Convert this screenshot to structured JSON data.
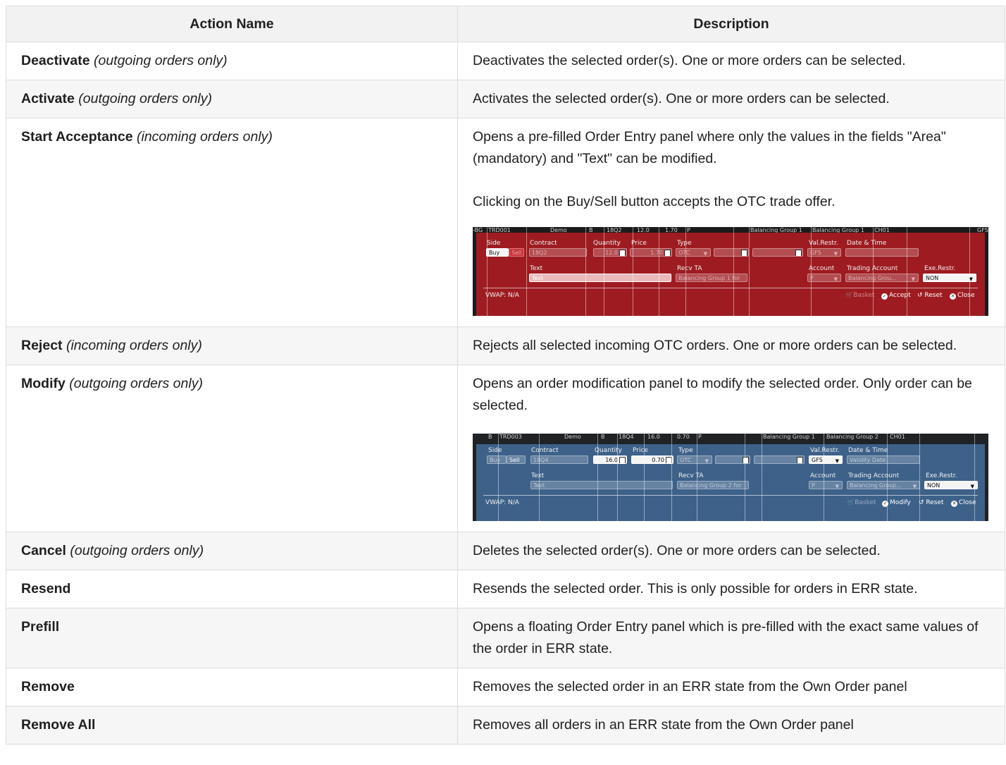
{
  "headers": {
    "name": "Action Name",
    "description": "Description"
  },
  "rows": [
    {
      "action": "Deactivate",
      "note": "(outgoing orders only)",
      "desc": [
        "Deactivates the selected order(s). One or more orders can be selected."
      ]
    },
    {
      "action": "Activate",
      "note": "(outgoing orders only)",
      "desc": [
        "Activates the selected order(s). One or more orders can be selected."
      ]
    },
    {
      "action": "Start Acceptance",
      "note": "(incoming orders only)",
      "desc": [
        "Opens a pre-filled Order Entry panel where only the values in the fields \"Area\" (mandatory) and \"Text\" can be modified.",
        "Clicking on the Buy/Sell button accepts the OTC trade offer."
      ]
    },
    {
      "action": "Reject",
      "note": "(incoming orders only)",
      "desc": [
        "Rejects all selected incoming OTC orders. One or more orders can be selected."
      ]
    },
    {
      "action": "Modify",
      "note": "(outgoing orders only)",
      "desc": [
        "Opens an order modification panel to modify the selected order. Only order can be selected."
      ]
    },
    {
      "action": "Cancel",
      "note": "(outgoing orders only)",
      "desc": [
        "Deletes the selected order(s). One or more orders can be selected."
      ]
    },
    {
      "action": "Resend",
      "note": "",
      "desc": [
        "Resends the selected order. This is only possible for orders in ERR state."
      ]
    },
    {
      "action": "Prefill",
      "note": "",
      "desc": [
        "Opens a floating Order Entry panel which is pre-filled with the exact same values of the order in ERR state."
      ]
    },
    {
      "action": "Remove",
      "note": "",
      "desc": [
        "Removes the selected order in an ERR state from the Own Order panel"
      ]
    },
    {
      "action": "Remove All",
      "note": "",
      "desc": [
        "Removes all orders in an ERR state from the Own Order panel"
      ]
    }
  ],
  "accept_panel": {
    "top_strip": [
      "-BG",
      "TRD001",
      "Demo",
      "B",
      "18Q2",
      "12.0",
      "1.70",
      "P",
      "Balancing Group 1",
      "Balancing Group 1",
      "CH01",
      "GFS"
    ],
    "labels": {
      "side": "Side",
      "contract": "Contract",
      "quantity": "Quantity",
      "price": "Price",
      "type": "Type",
      "val_restr": "Val.Restr.",
      "date_time": "Date & Time",
      "text": "Text",
      "recv_ta": "Recv TA",
      "account": "Account",
      "trading_account": "Trading Account",
      "exe_restr": "Exe.Restr."
    },
    "values": {
      "buy": "Buy",
      "sell": "Sell",
      "contract": "18Q2",
      "quantity": "12.0",
      "price": "1.70",
      "type": "OTC",
      "val_restr": "GFS",
      "text_placeholder": "Text",
      "recv_ta": "Balancing Group 1 for",
      "account": "P",
      "trading_account": "Balancing Grou...",
      "exe_restr": "NON"
    },
    "vwap": "VWAP:  N/A",
    "buttons": {
      "basket": "Basket",
      "action": "Accept",
      "reset": "Reset",
      "close": "Close"
    }
  },
  "modify_panel": {
    "top_strip": [
      "B",
      "TRD003",
      "Demo",
      "B",
      "18Q4",
      "16.0",
      "0.70",
      "P",
      "Balancing Group 1",
      "Balancing Group 2",
      "CH01"
    ],
    "labels": {
      "side": "Side",
      "contract": "Contract",
      "quantity": "Quantity",
      "price": "Price",
      "type": "Type",
      "val_restr": "Val.Restr.",
      "date_time": "Date & Time",
      "text": "Text",
      "recv_ta": "Recv TA",
      "account": "Account",
      "trading_account": "Trading Account",
      "exe_restr": "Exe.Restr."
    },
    "values": {
      "buy": "Buy",
      "sell": "Sell",
      "contract": "18Q4",
      "quantity": "16.0",
      "price": "0.70",
      "type": "OTC",
      "val_restr": "GFS",
      "date_placeholder": "Validity Date",
      "text_placeholder": "Text",
      "recv_ta": "Balancing Group 2 for",
      "account": "P",
      "trading_account": "Balancing Group...",
      "exe_restr": "NON"
    },
    "vwap": "VWAP:  N/A",
    "buttons": {
      "basket": "Basket",
      "action": "Modify",
      "reset": "Reset",
      "close": "Close"
    }
  }
}
